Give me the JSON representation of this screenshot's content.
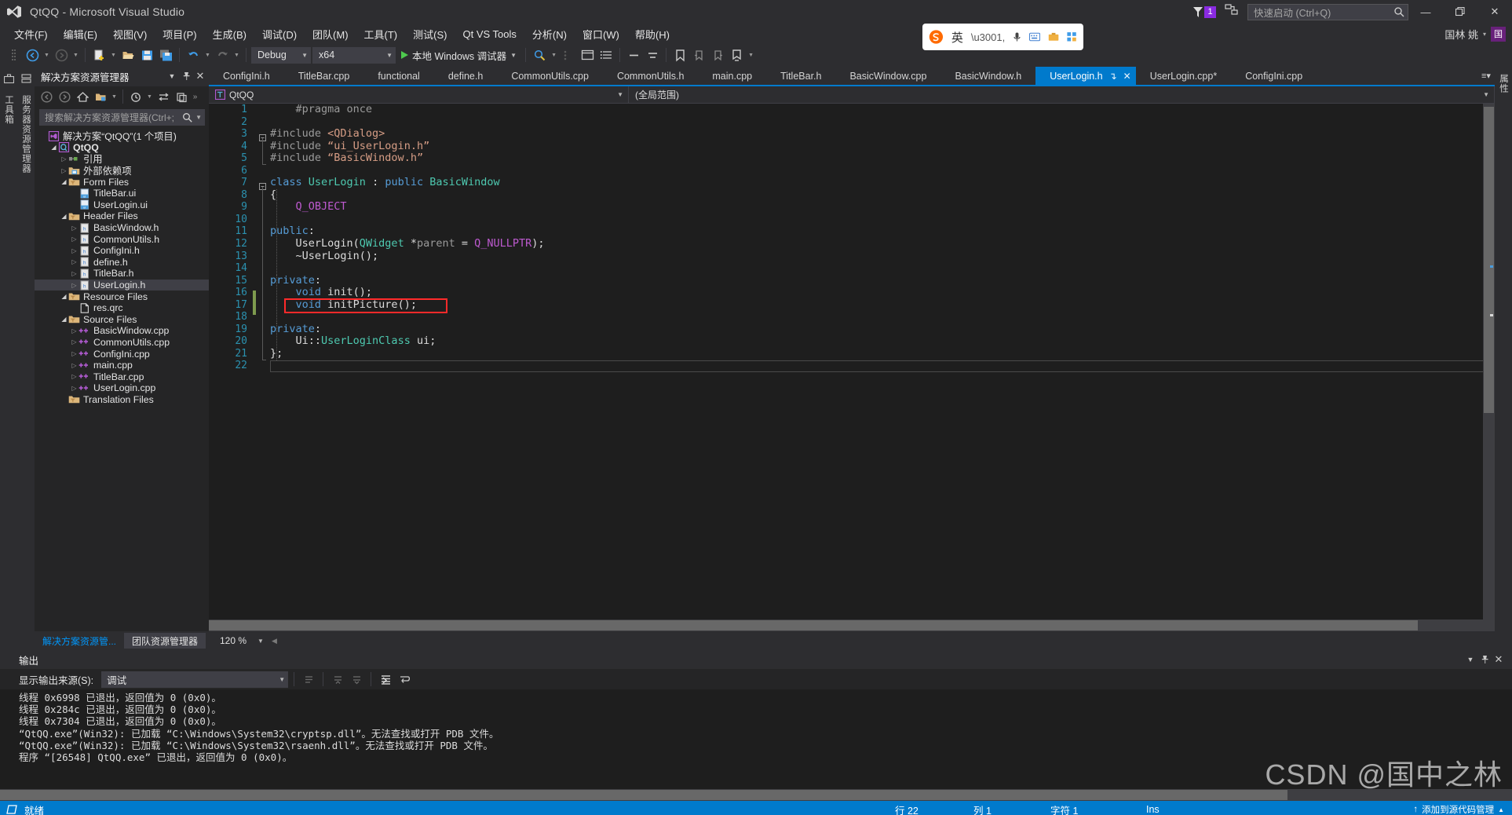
{
  "window": {
    "title": "QtQQ - Microsoft Visual Studio",
    "logo_icon": "visual-studio-logo",
    "minimize_label": "—",
    "restore_label": "❐",
    "close_label": "✕",
    "notification_count": "1",
    "feedback_icon": "feedback-icon",
    "flag_icon": "notification-flag-icon"
  },
  "quick_launch": {
    "placeholder": "快速启动 (Ctrl+Q)",
    "icon": "search-icon"
  },
  "menu": {
    "items": [
      "文件(F)",
      "编辑(E)",
      "视图(V)",
      "项目(P)",
      "生成(B)",
      "调试(D)",
      "团队(M)",
      "工具(T)",
      "测试(S)",
      "Qt VS Tools",
      "分析(N)",
      "窗口(W)",
      "帮助(H)"
    ],
    "user": "国林 姚",
    "avatar_initial": "国"
  },
  "toolbar": {
    "config_value": "Debug",
    "platform_value": "x64",
    "run_label": "本地 Windows 调试器",
    "sogou_label": "英",
    "back_icon": "navigate-back-icon",
    "forward_icon": "navigate-forward-icon",
    "new_item_icon": "new-item-icon",
    "open_file_icon": "open-file-icon",
    "save_icon": "save-icon",
    "save_all_icon": "save-all-icon",
    "undo_icon": "undo-icon",
    "redo_icon": "redo-icon",
    "run_icon": "start-debugging-icon",
    "find_icon": "find-icon",
    "window_icon": "window-layout-icon",
    "list_icon": "list-icon",
    "zoom_out_icon": "zoom-out-icon",
    "zoom_in_icon": "zoom-in-icon",
    "bookmark_icons": "bookmark-icon"
  },
  "solution_explorer": {
    "title": "解决方案资源管理器",
    "caret_icon": "chevron-down-icon",
    "pin_icon": "pin-icon",
    "close_icon": "close-icon",
    "search_placeholder": "搜索解决方案资源管理器(Ctrl+;",
    "search_icon": "search-icon",
    "toolbar_icons": [
      "back-icon",
      "forward-icon",
      "home-icon",
      "show-all-files-icon",
      "dropdown-icon",
      "pending-changes-icon",
      "sync-icon",
      "properties-icon",
      "overflow-icon"
    ],
    "tree": [
      {
        "indent": 0,
        "arrow": "none",
        "icon": "solution-icon",
        "label": "解决方案“QtQQ”(1 个项目)",
        "bold": false,
        "selected": false
      },
      {
        "indent": 1,
        "arrow": "open",
        "icon": "qt-project-icon",
        "label": "QtQQ",
        "bold": true,
        "selected": false
      },
      {
        "indent": 2,
        "arrow": "closed",
        "icon": "references-icon",
        "label": "引用",
        "bold": false,
        "selected": false
      },
      {
        "indent": 2,
        "arrow": "closed",
        "icon": "folder-ext-icon",
        "label": "外部依赖项",
        "bold": false,
        "selected": false
      },
      {
        "indent": 2,
        "arrow": "open",
        "icon": "filter-folder-icon",
        "label": "Form Files",
        "bold": false,
        "selected": false
      },
      {
        "indent": 3,
        "arrow": "none",
        "icon": "ui-file-icon",
        "label": "TitleBar.ui",
        "bold": false,
        "selected": false
      },
      {
        "indent": 3,
        "arrow": "none",
        "icon": "ui-file-icon",
        "label": "UserLogin.ui",
        "bold": false,
        "selected": false
      },
      {
        "indent": 2,
        "arrow": "open",
        "icon": "filter-folder-icon",
        "label": "Header Files",
        "bold": false,
        "selected": false
      },
      {
        "indent": 3,
        "arrow": "closed",
        "icon": "h-file-icon",
        "label": "BasicWindow.h",
        "bold": false,
        "selected": false
      },
      {
        "indent": 3,
        "arrow": "closed",
        "icon": "h-file-icon",
        "label": "CommonUtils.h",
        "bold": false,
        "selected": false
      },
      {
        "indent": 3,
        "arrow": "closed",
        "icon": "h-file-icon",
        "label": "ConfigIni.h",
        "bold": false,
        "selected": false
      },
      {
        "indent": 3,
        "arrow": "closed",
        "icon": "h-file-icon",
        "label": "define.h",
        "bold": false,
        "selected": false
      },
      {
        "indent": 3,
        "arrow": "closed",
        "icon": "h-file-icon",
        "label": "TitleBar.h",
        "bold": false,
        "selected": false
      },
      {
        "indent": 3,
        "arrow": "closed",
        "icon": "h-file-icon",
        "label": "UserLogin.h",
        "bold": false,
        "selected": true
      },
      {
        "indent": 2,
        "arrow": "open",
        "icon": "filter-folder-icon",
        "label": "Resource Files",
        "bold": false,
        "selected": false
      },
      {
        "indent": 3,
        "arrow": "none",
        "icon": "qrc-file-icon",
        "label": "res.qrc",
        "bold": false,
        "selected": false
      },
      {
        "indent": 2,
        "arrow": "open",
        "icon": "filter-folder-icon",
        "label": "Source Files",
        "bold": false,
        "selected": false
      },
      {
        "indent": 3,
        "arrow": "closed",
        "icon": "cpp-file-icon",
        "label": "BasicWindow.cpp",
        "bold": false,
        "selected": false
      },
      {
        "indent": 3,
        "arrow": "closed",
        "icon": "cpp-file-icon",
        "label": "CommonUtils.cpp",
        "bold": false,
        "selected": false
      },
      {
        "indent": 3,
        "arrow": "closed",
        "icon": "cpp-file-icon",
        "label": "ConfigIni.cpp",
        "bold": false,
        "selected": false
      },
      {
        "indent": 3,
        "arrow": "closed",
        "icon": "cpp-file-icon",
        "label": "main.cpp",
        "bold": false,
        "selected": false
      },
      {
        "indent": 3,
        "arrow": "closed",
        "icon": "cpp-file-icon",
        "label": "TitleBar.cpp",
        "bold": false,
        "selected": false
      },
      {
        "indent": 3,
        "arrow": "closed",
        "icon": "cpp-file-icon",
        "label": "UserLogin.cpp",
        "bold": false,
        "selected": false
      },
      {
        "indent": 2,
        "arrow": "none",
        "icon": "filter-folder-icon",
        "label": "Translation Files",
        "bold": false,
        "selected": false
      }
    ],
    "bottom_tabs": [
      {
        "label": "解决方案资源管...",
        "selected": true
      },
      {
        "label": "团队资源管理器",
        "selected": false
      }
    ],
    "zoom_value": "120 %"
  },
  "left_strips": {
    "outer_label": "工具箱",
    "inner_label": "服务器资源管理器"
  },
  "right_strips": {
    "label": "属性"
  },
  "editor": {
    "tabs": [
      {
        "label": "ConfigIni.h",
        "active": false
      },
      {
        "label": "TitleBar.cpp",
        "active": false
      },
      {
        "label": "functional",
        "active": false
      },
      {
        "label": "define.h",
        "active": false
      },
      {
        "label": "CommonUtils.cpp",
        "active": false
      },
      {
        "label": "CommonUtils.h",
        "active": false
      },
      {
        "label": "main.cpp",
        "active": false
      },
      {
        "label": "TitleBar.h",
        "active": false
      },
      {
        "label": "BasicWindow.cpp",
        "active": false
      },
      {
        "label": "BasicWindow.h",
        "active": false
      },
      {
        "label": "UserLogin.h",
        "active": true
      },
      {
        "label": "UserLogin.cpp*",
        "active": false
      },
      {
        "label": "ConfigIni.cpp",
        "active": false
      }
    ],
    "tab_pin_icon": "pin-icon",
    "tab_close_icon": "close-icon",
    "tab_overflow_icon": "tab-overflow-icon",
    "nav_project": "QtQQ",
    "nav_project_icon": "qt-project-icon",
    "nav_scope": "(全局范围)",
    "lines": [
      {
        "n": "1",
        "spans": [
          {
            "t": "    ",
            "c": "id"
          },
          {
            "t": "#pragma once",
            "c": "pp"
          }
        ]
      },
      {
        "n": "2",
        "spans": []
      },
      {
        "n": "3",
        "spans": [
          {
            "t": "#include ",
            "c": "pp"
          },
          {
            "t": "<QDialog>",
            "c": "str"
          }
        ],
        "fold": "open"
      },
      {
        "n": "4",
        "spans": [
          {
            "t": "#include ",
            "c": "pp"
          },
          {
            "t": "“ui_UserLogin.h”",
            "c": "str"
          }
        ]
      },
      {
        "n": "5",
        "spans": [
          {
            "t": "#include ",
            "c": "pp"
          },
          {
            "t": "“BasicWindow.h”",
            "c": "str"
          }
        ]
      },
      {
        "n": "6",
        "spans": []
      },
      {
        "n": "7",
        "spans": [
          {
            "t": "class ",
            "c": "kw"
          },
          {
            "t": "UserLogin",
            "c": "typ"
          },
          {
            "t": " : ",
            "c": "id"
          },
          {
            "t": "public ",
            "c": "kw"
          },
          {
            "t": "BasicWindow",
            "c": "typ"
          }
        ],
        "fold": "open"
      },
      {
        "n": "8",
        "spans": [
          {
            "t": "{",
            "c": "id"
          }
        ]
      },
      {
        "n": "9",
        "spans": [
          {
            "t": "    ",
            "c": "id"
          },
          {
            "t": "Q_OBJECT",
            "c": "mac"
          }
        ]
      },
      {
        "n": "10",
        "spans": []
      },
      {
        "n": "11",
        "spans": [
          {
            "t": "public",
            "c": "kw"
          },
          {
            "t": ":",
            "c": "id"
          }
        ]
      },
      {
        "n": "12",
        "spans": [
          {
            "t": "    UserLogin(",
            "c": "id"
          },
          {
            "t": "QWidget",
            "c": "typ"
          },
          {
            "t": " *",
            "c": "id"
          },
          {
            "t": "parent",
            "c": "prm"
          },
          {
            "t": " = ",
            "c": "id"
          },
          {
            "t": "Q_NULLPTR",
            "c": "mac"
          },
          {
            "t": ");",
            "c": "id"
          }
        ]
      },
      {
        "n": "13",
        "spans": [
          {
            "t": "    ~UserLogin();",
            "c": "id"
          }
        ]
      },
      {
        "n": "14",
        "spans": []
      },
      {
        "n": "15",
        "spans": [
          {
            "t": "private",
            "c": "kw"
          },
          {
            "t": ":",
            "c": "id"
          }
        ]
      },
      {
        "n": "16",
        "spans": [
          {
            "t": "    ",
            "c": "id"
          },
          {
            "t": "void",
            "c": "kw"
          },
          {
            "t": " init();",
            "c": "id"
          }
        ],
        "changed": true
      },
      {
        "n": "17",
        "spans": [
          {
            "t": "    ",
            "c": "id"
          },
          {
            "t": "void",
            "c": "kw"
          },
          {
            "t": " initPicture();",
            "c": "id"
          }
        ],
        "changed": true,
        "highlighted": true
      },
      {
        "n": "18",
        "spans": []
      },
      {
        "n": "19",
        "spans": [
          {
            "t": "private",
            "c": "kw"
          },
          {
            "t": ":",
            "c": "id"
          }
        ]
      },
      {
        "n": "20",
        "spans": [
          {
            "t": "    Ui::",
            "c": "id"
          },
          {
            "t": "UserLoginClass",
            "c": "typ"
          },
          {
            "t": " ui;",
            "c": "id"
          }
        ]
      },
      {
        "n": "21",
        "spans": [
          {
            "t": "};",
            "c": "id"
          }
        ]
      },
      {
        "n": "22",
        "spans": []
      }
    ]
  },
  "output": {
    "title": "输出",
    "caret_icon": "chevron-down-icon",
    "pin_icon": "pin-icon",
    "close_icon": "close-icon",
    "source_label": "显示输出来源(S):",
    "source_value": "调试",
    "toolbar_icons": [
      "find-message-icon",
      "jump-prev-icon",
      "jump-next-icon",
      "clear-all-icon",
      "word-wrap-icon"
    ],
    "lines": [
      "线程 0x6998 已退出，返回值为 0 (0x0)。",
      "线程 0x284c 已退出，返回值为 0 (0x0)。",
      "线程 0x7304 已退出，返回值为 0 (0x0)。",
      "“QtQQ.exe”(Win32): 已加载 “C:\\Windows\\System32\\cryptsp.dll”。无法查找或打开 PDB 文件。",
      "“QtQQ.exe”(Win32): 已加载 “C:\\Windows\\System32\\rsaenh.dll”。无法查找或打开 PDB 文件。",
      "程序 “[26548] QtQQ.exe” 已退出，返回值为 0 (0x0)。"
    ]
  },
  "status_bar": {
    "ready": "就绪",
    "ready_icon": "ready-icon",
    "line": "行 22",
    "col": "列 1",
    "char": "字符 1",
    "ins": "Ins",
    "source_control": "添加到源代码管理",
    "source_control_icon": "source-control-icon",
    "expand_icon": "expand-icon"
  },
  "watermark": {
    "text": "CSDN @国中之林"
  },
  "colors": {
    "accent": "#007acc",
    "chrome": "#2d2d30",
    "panel": "#252526",
    "editor_bg": "#1e1e1e",
    "highlight": "#ff2a2a",
    "badge": "#8a2be2",
    "avatar": "#68217a"
  }
}
